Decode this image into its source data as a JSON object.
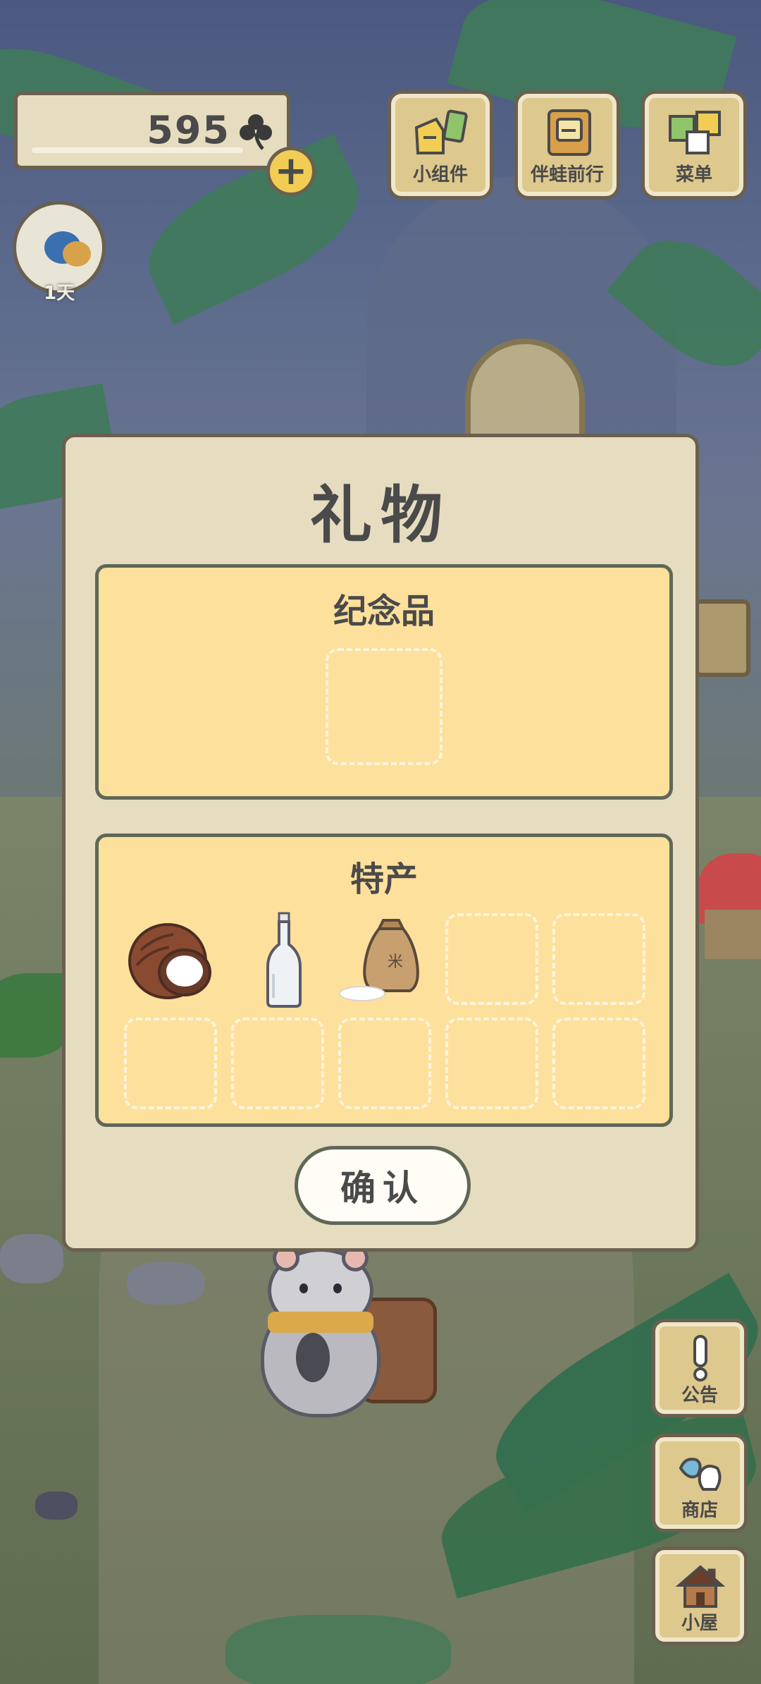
{
  "currency": {
    "clover_count": "595",
    "icon": "clover-icon"
  },
  "top_menu": [
    {
      "label": "小组件",
      "icon": "widget-icon"
    },
    {
      "label": "伴蛙前行",
      "icon": "book-icon"
    },
    {
      "label": "菜单",
      "icon": "menu-icon"
    }
  ],
  "day": {
    "label": "1天"
  },
  "dialog": {
    "title": "礼物",
    "souvenir": {
      "title": "纪念品"
    },
    "specialty": {
      "title": "特产",
      "items": [
        {
          "name": "coconut",
          "icon": "coconut-icon"
        },
        {
          "name": "bottle",
          "icon": "bottle-icon"
        },
        {
          "name": "rice-bag",
          "icon": "rice-bag-icon"
        }
      ]
    },
    "confirm_label": "确认"
  },
  "side_menu": [
    {
      "label": "公告",
      "icon": "notice-icon"
    },
    {
      "label": "商店",
      "icon": "shop-icon"
    },
    {
      "label": "小屋",
      "icon": "house-icon"
    }
  ],
  "colors": {
    "panel": "#fde09c",
    "dialog": "#e6dcc0",
    "button": "#ddc88e",
    "accent": "#f1cd54"
  }
}
